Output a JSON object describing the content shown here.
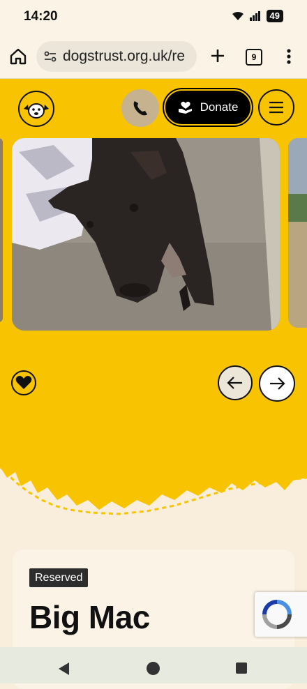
{
  "status_bar": {
    "time": "14:20",
    "battery": "49"
  },
  "browser": {
    "url": "dogstrust.org.uk/re",
    "tab_count": "9"
  },
  "header": {
    "donate_label": "Donate"
  },
  "colors": {
    "brand_yellow": "#f8c401",
    "cream": "#f8eedb",
    "black": "#111111"
  },
  "icons": [
    "home-icon",
    "site-settings-icon",
    "plus-icon",
    "tab-switcher-icon",
    "more-vert-icon",
    "dogs-trust-logo",
    "phone-icon",
    "donate-heart-hand-icon",
    "hamburger-icon",
    "heart-icon",
    "arrow-left-icon",
    "arrow-right-icon",
    "recaptcha-icon"
  ],
  "dog": {
    "status_badge": "Reserved",
    "name": "Big Mac"
  }
}
